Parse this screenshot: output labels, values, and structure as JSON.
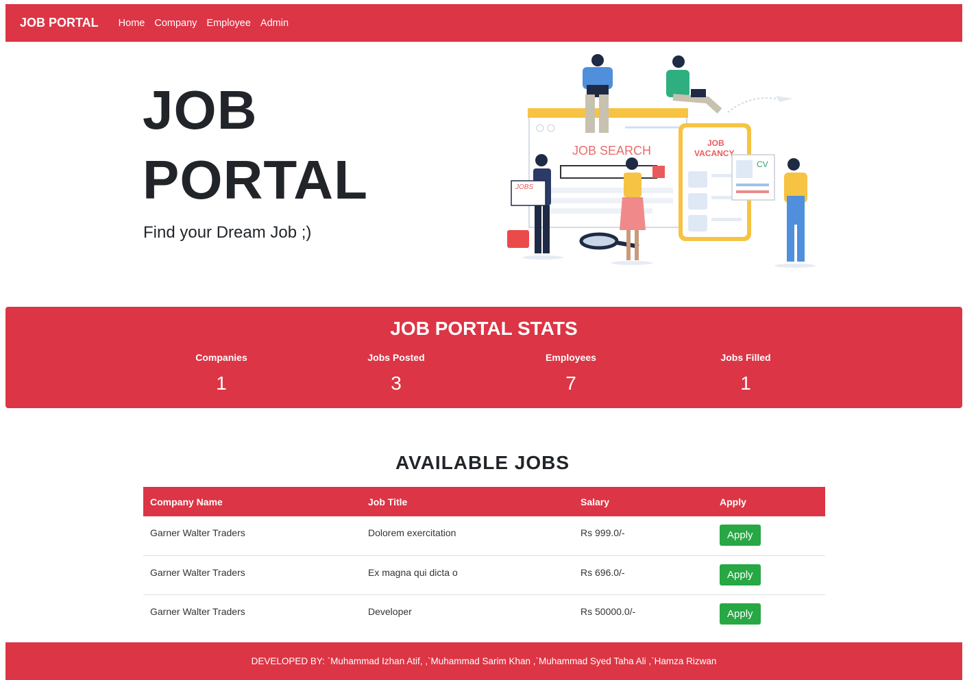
{
  "navbar": {
    "brand": "JOB PORTAL",
    "links": [
      "Home",
      "Company",
      "Employee",
      "Admin"
    ]
  },
  "hero": {
    "title_line1": "JOB",
    "title_line2": "PORTAL",
    "subtitle": "Find your Dream Job ;)",
    "illustration": {
      "job_search_text": "JOB SEARCH",
      "job_vacancy_line1": "JOB",
      "job_vacancy_line2": "VACANCY",
      "cv_text": "CV",
      "jobs_paper_text": "JOBS"
    }
  },
  "stats": {
    "title": "JOB PORTAL STATS",
    "items": [
      {
        "label": "Companies",
        "value": "1"
      },
      {
        "label": "Jobs Posted",
        "value": "3"
      },
      {
        "label": "Employees",
        "value": "7"
      },
      {
        "label": "Jobs Filled",
        "value": "1"
      }
    ]
  },
  "jobs": {
    "title": "AVAILABLE JOBS",
    "columns": [
      "Company Name",
      "Job Title",
      "Salary",
      "Apply"
    ],
    "rows": [
      {
        "company": "Garner Walter Traders",
        "title": "Dolorem exercitation",
        "salary": "Rs 999.0/-",
        "apply_label": "Apply"
      },
      {
        "company": "Garner Walter Traders",
        "title": "Ex magna qui dicta o",
        "salary": "Rs 696.0/-",
        "apply_label": "Apply"
      },
      {
        "company": "Garner Walter Traders",
        "title": "Developer",
        "salary": "Rs 50000.0/-",
        "apply_label": "Apply"
      }
    ]
  },
  "footer": {
    "text": "DEVELOPED BY: `Muhammad Izhan Atif, ,`Muhammad Sarim Khan ,`Muhammad Syed Taha Ali ,`Hamza Rizwan"
  },
  "colors": {
    "primary": "#dc3545",
    "success": "#28a745",
    "text": "#212529"
  }
}
